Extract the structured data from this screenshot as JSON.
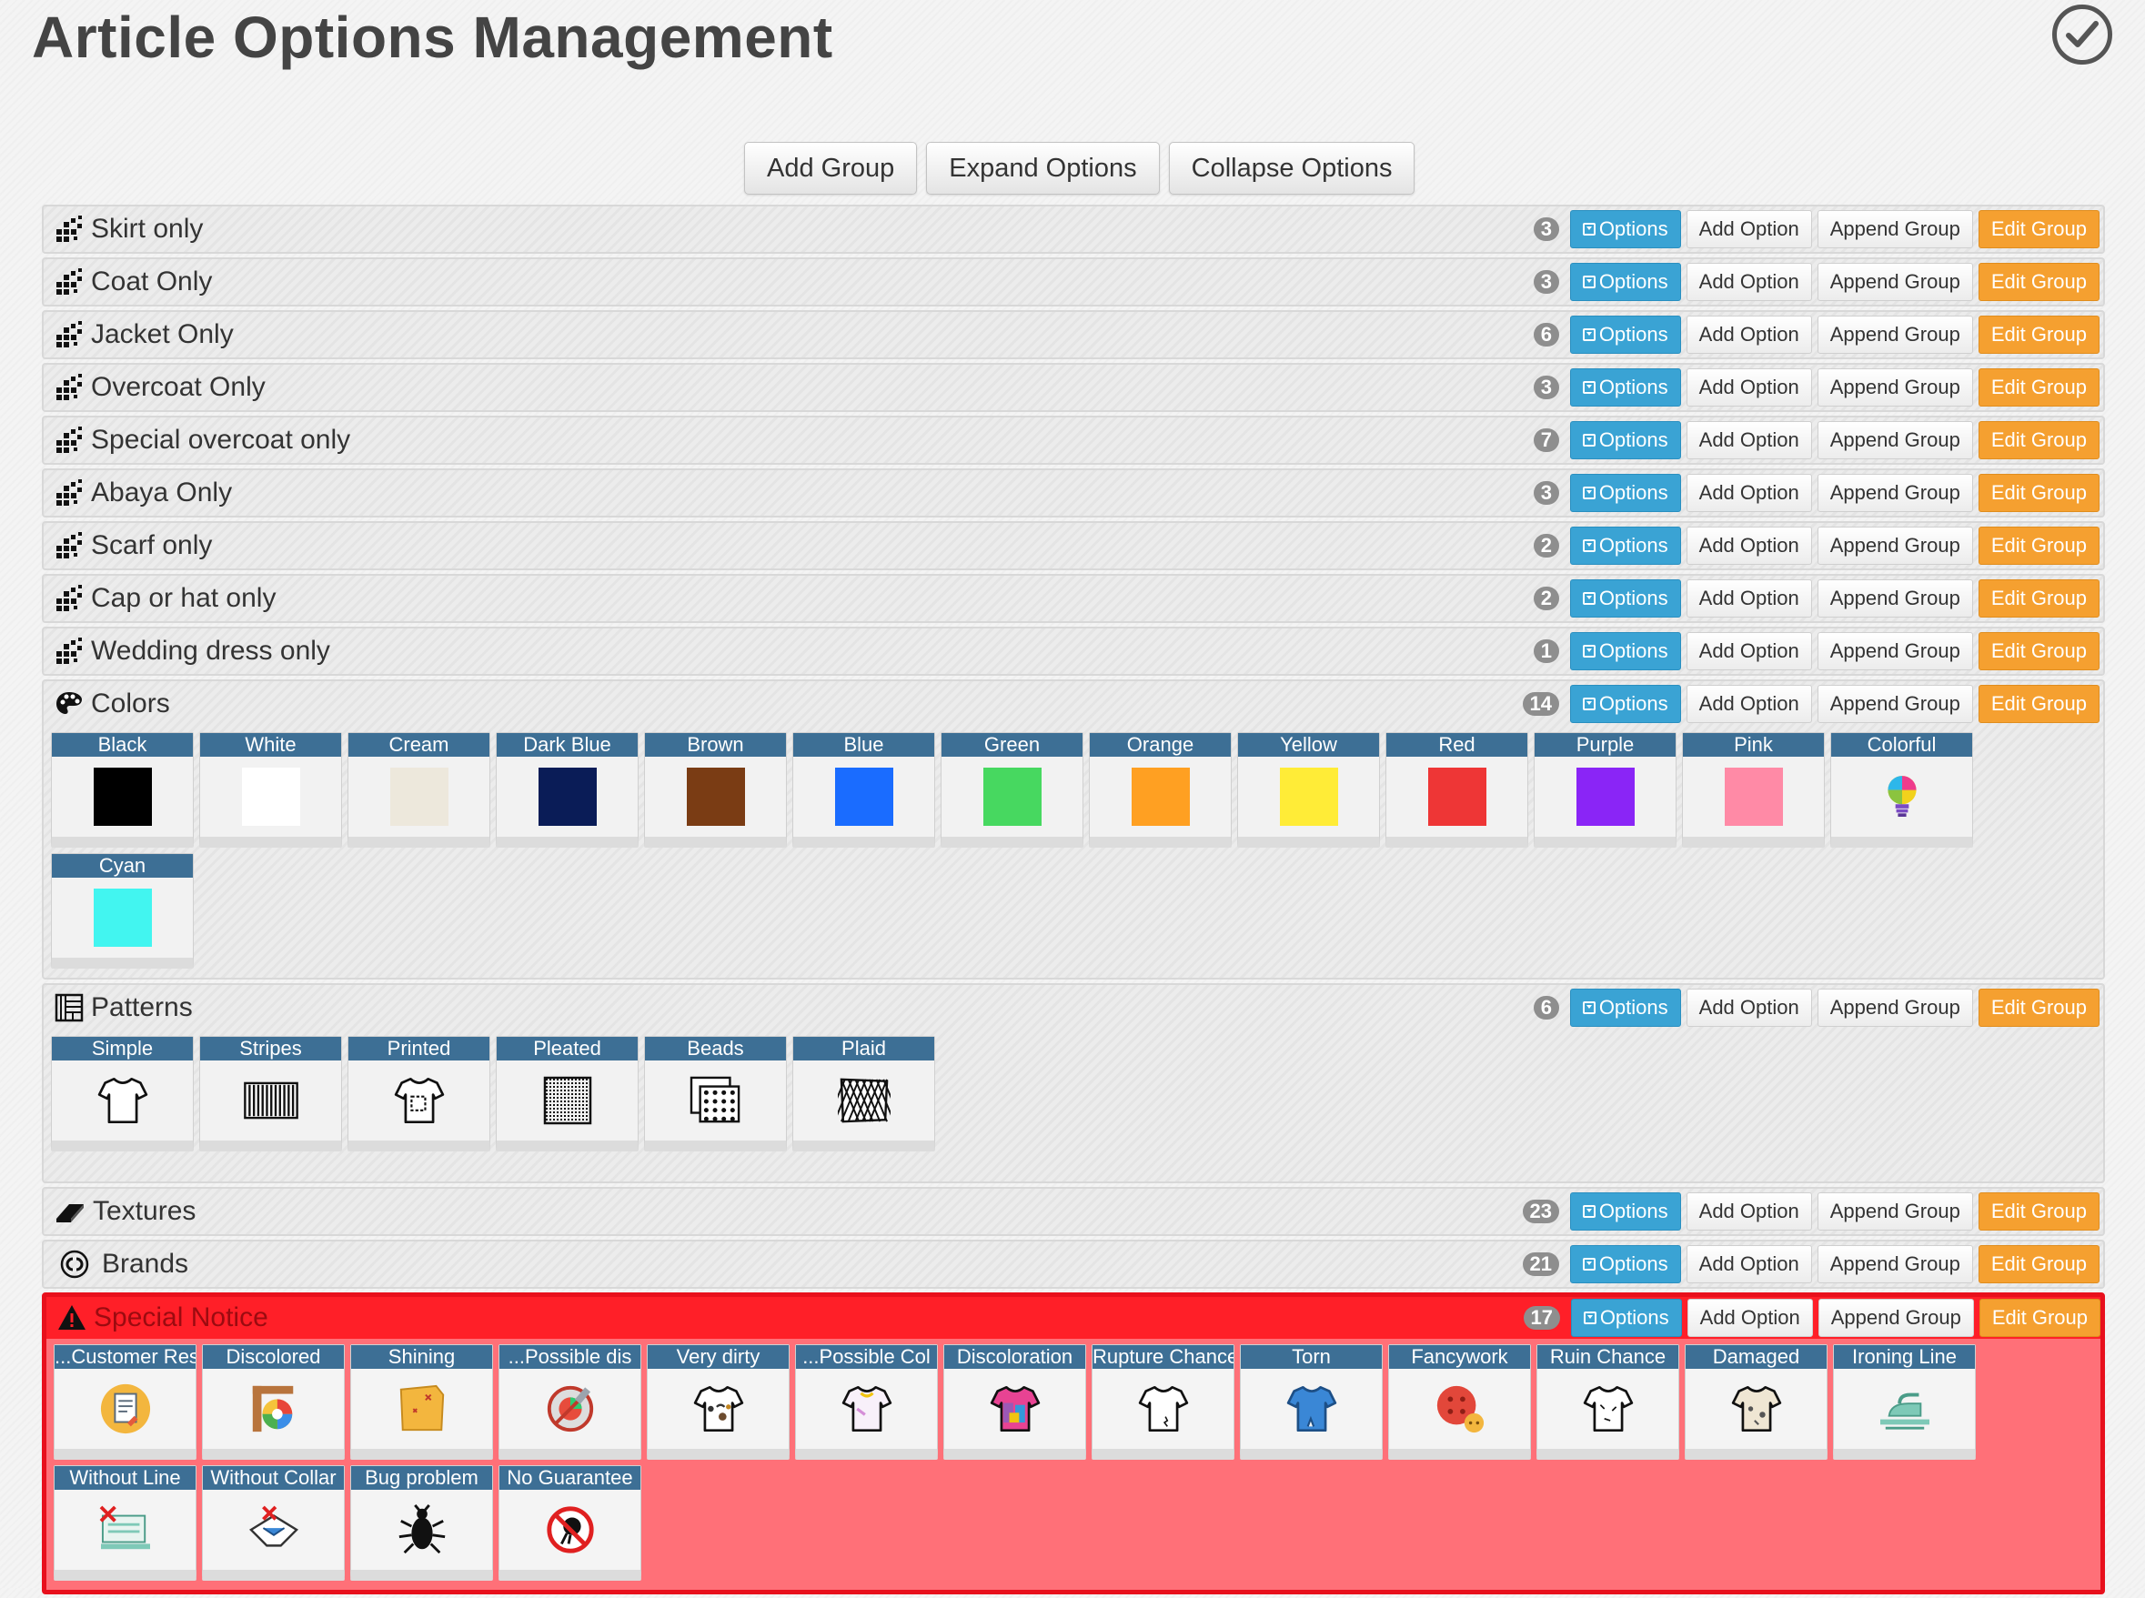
{
  "page": {
    "title": "Article Options Management"
  },
  "toolbar": {
    "add_group": "Add Group",
    "expand": "Expand Options",
    "collapse": "Collapse Options"
  },
  "actions": {
    "options": "Options",
    "add_option": "Add Option",
    "append_group": "Append Group",
    "edit_group": "Edit Group"
  },
  "groups": [
    {
      "name": "Skirt only",
      "count": "3",
      "icon": "dots-icon"
    },
    {
      "name": "Coat Only",
      "count": "3",
      "icon": "dots-icon"
    },
    {
      "name": "Jacket Only",
      "count": "6",
      "icon": "dots-icon"
    },
    {
      "name": "Overcoat Only",
      "count": "3",
      "icon": "dots-icon"
    },
    {
      "name": "Special overcoat only",
      "count": "7",
      "icon": "dots-icon"
    },
    {
      "name": "Abaya Only",
      "count": "3",
      "icon": "dots-icon"
    },
    {
      "name": "Scarf only",
      "count": "2",
      "icon": "dots-icon"
    },
    {
      "name": "Cap or hat only",
      "count": "2",
      "icon": "dots-icon"
    },
    {
      "name": "Wedding dress only",
      "count": "1",
      "icon": "dots-icon"
    },
    {
      "name": "Colors",
      "count": "14",
      "icon": "palette-icon",
      "options": [
        {
          "label": "Black",
          "color": "#000000"
        },
        {
          "label": "White",
          "color": "#ffffff"
        },
        {
          "label": "Cream",
          "color": "#ede8dc"
        },
        {
          "label": "Dark Blue",
          "color": "#0a1c57"
        },
        {
          "label": "Brown",
          "color": "#7a3c14"
        },
        {
          "label": "Blue",
          "color": "#1a6cff"
        },
        {
          "label": "Green",
          "color": "#47d860"
        },
        {
          "label": "Orange",
          "color": "#ffa022"
        },
        {
          "label": "Yellow",
          "color": "#ffec37"
        },
        {
          "label": "Red",
          "color": "#ee3636"
        },
        {
          "label": "Purple",
          "color": "#8a25f6"
        },
        {
          "label": "Pink",
          "color": "#ff8aa6"
        },
        {
          "label": "Colorful",
          "icon": "lightbulb-icon"
        },
        {
          "label": "Cyan",
          "color": "#42f5f0"
        }
      ]
    },
    {
      "name": "Patterns",
      "count": "6",
      "icon": "pattern-icon",
      "options": [
        {
          "label": "Simple",
          "icon": "tshirt-plain-icon"
        },
        {
          "label": "Stripes",
          "icon": "stripes-icon"
        },
        {
          "label": "Printed",
          "icon": "tshirt-printed-icon"
        },
        {
          "label": "Pleated",
          "icon": "pleated-icon"
        },
        {
          "label": "Beads",
          "icon": "beads-icon"
        },
        {
          "label": "Plaid",
          "icon": "plaid-icon"
        }
      ]
    },
    {
      "name": "Textures",
      "count": "23",
      "icon": "eraser-icon"
    },
    {
      "name": "Brands",
      "count": "21",
      "icon": "brand-logo-icon"
    },
    {
      "name": "Special Notice",
      "count": "17",
      "icon": "warning-icon",
      "options": [
        {
          "label": "...Customer Res",
          "icon": "clipboard-icon"
        },
        {
          "label": "Discolored",
          "icon": "color-wheel-icon"
        },
        {
          "label": "Shining",
          "icon": "shining-fabric-icon"
        },
        {
          "label": "...Possible dis",
          "icon": "no-color-icon"
        },
        {
          "label": "Very dirty",
          "icon": "dirty-shirt-icon"
        },
        {
          "label": "...Possible Col",
          "icon": "collar-shirt-icon"
        },
        {
          "label": "Discoloration",
          "icon": "discolored-shirt-icon"
        },
        {
          "label": "Rupture Chance",
          "icon": "rupture-shirt-icon"
        },
        {
          "label": "Torn",
          "icon": "torn-shirt-icon"
        },
        {
          "label": "Fancywork",
          "icon": "button-icon"
        },
        {
          "label": "Ruin Chance",
          "icon": "ruin-shirt-icon"
        },
        {
          "label": "Damaged",
          "icon": "damaged-shirt-icon"
        },
        {
          "label": "Ironing Line",
          "icon": "iron-icon"
        },
        {
          "label": "Without Line",
          "icon": "iron-crossed-icon"
        },
        {
          "label": "Without Collar",
          "icon": "collar-crossed-icon"
        },
        {
          "label": "Bug problem",
          "icon": "bug-icon"
        },
        {
          "label": "No Guarantee",
          "icon": "no-guarantee-icon"
        }
      ]
    }
  ]
}
